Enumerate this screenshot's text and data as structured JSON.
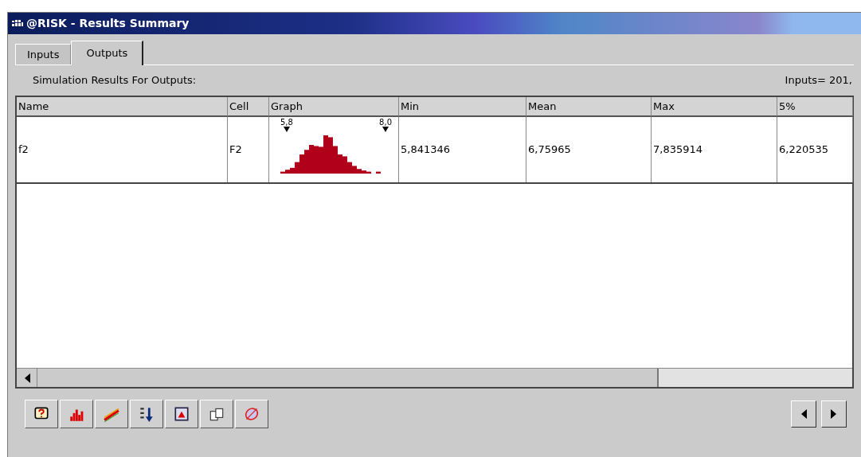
{
  "window": {
    "title": "@RISK - Results Summary"
  },
  "tabs": [
    {
      "label": "Inputs",
      "selected": false
    },
    {
      "label": "Outputs",
      "selected": true
    }
  ],
  "results_label": "Simulation Results For Outputs:",
  "inputs_count": "Inputs= 201,",
  "table": {
    "columns": [
      "Name",
      "Cell",
      "Graph",
      "Min",
      "Mean",
      "Max",
      "5%"
    ],
    "rows": [
      {
        "name": "f2",
        "cell": "F2",
        "graph": {
          "left_label": "5,8",
          "right_label": "8,0"
        },
        "min": "5,841346",
        "mean": "6,75965",
        "max": "7,835914",
        "p5": "6,220535"
      }
    ]
  }
}
